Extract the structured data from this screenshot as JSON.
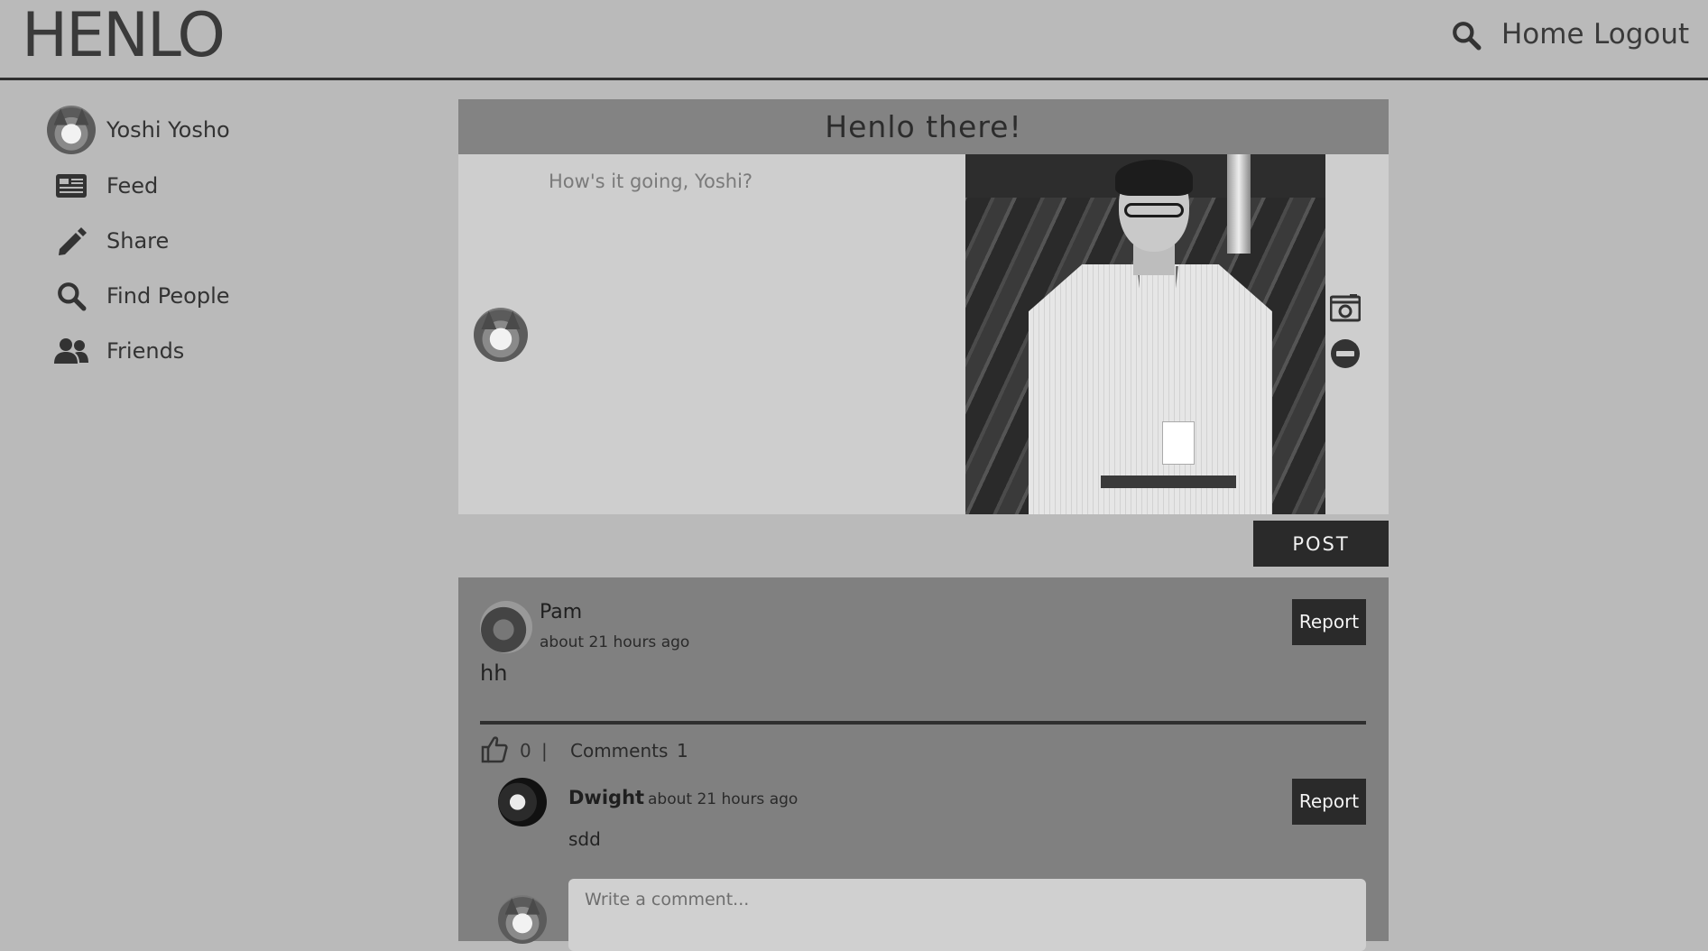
{
  "header": {
    "logo": "HENLO",
    "nav": {
      "home": "Home",
      "logout": "Logout"
    }
  },
  "sidebar": {
    "profile_name": "Yoshi Yosho",
    "items": [
      {
        "label": "Feed",
        "icon": "newspaper-icon"
      },
      {
        "label": "Share",
        "icon": "pencil-icon"
      },
      {
        "label": "Find People",
        "icon": "search-icon"
      },
      {
        "label": "Friends",
        "icon": "users-icon"
      }
    ]
  },
  "composer": {
    "title": "Henlo there!",
    "placeholder": "How's it going, Yoshi?",
    "post_button": "POST"
  },
  "post": {
    "author": "Pam",
    "time": "about 21 hours ago",
    "report_label": "Report",
    "body": "hh",
    "likes": "0",
    "separator": "|",
    "comments_label": "Comments",
    "comments_count": "1",
    "comment": {
      "author": "Dwight",
      "time": "about 21 hours ago",
      "report_label": "Report",
      "body": "sdd"
    },
    "reply_placeholder": "Write a comment..."
  },
  "colors": {
    "background": "#bababa",
    "header_border": "#2f2f2f",
    "composer_title_bg": "#838383",
    "composer_body_bg": "#cecece",
    "post_card_bg": "#808080",
    "button_bg": "#2a2a2a"
  }
}
